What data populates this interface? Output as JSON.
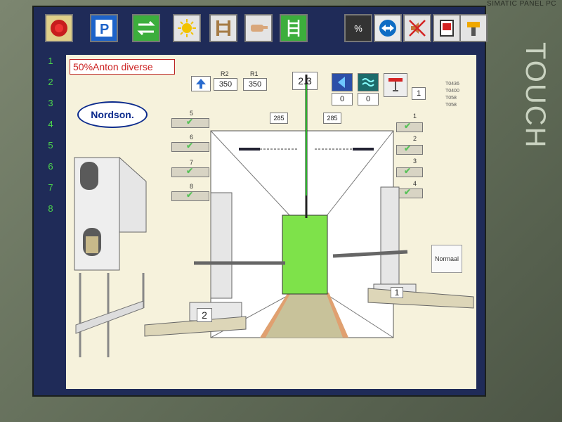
{
  "bezel": {
    "model": "SIMATIC PANEL PC",
    "touch": "TOUCH"
  },
  "toolbar": {
    "buttons": [
      {
        "name": "emergency-stop",
        "icon": "emergency-stop-icon"
      },
      {
        "name": "parking",
        "icon": "parking-icon"
      },
      {
        "name": "conveyor",
        "icon": "conveyor-icon"
      },
      {
        "name": "sun",
        "icon": "sun-icon"
      },
      {
        "name": "rails",
        "icon": "rails-icon"
      },
      {
        "name": "hand",
        "icon": "hand-icon"
      },
      {
        "name": "ladder",
        "icon": "ladder-icon"
      },
      {
        "name": "percent",
        "label": "%"
      },
      {
        "name": "teamviewer",
        "icon": "teamviewer-icon"
      },
      {
        "name": "mute",
        "icon": "mute-icon"
      },
      {
        "name": "tablet",
        "icon": "tablet-icon"
      },
      {
        "name": "tool",
        "icon": "tool-icon"
      }
    ]
  },
  "rows": [
    "1",
    "2",
    "3",
    "4",
    "5",
    "6",
    "7",
    "8"
  ],
  "recipe": {
    "name": "50%Anton diverse"
  },
  "logo": {
    "text": "Nordson."
  },
  "params": {
    "r2_label": "R2",
    "r2_value": "350",
    "r1_label": "R1",
    "r1_value": "350",
    "center_value": "2.3",
    "left_pos": "285",
    "right_pos": "285",
    "air_value": "0",
    "wave_value": "0",
    "count_value": "1"
  },
  "guns_left": [
    "5",
    "6",
    "7",
    "8"
  ],
  "guns_right": [
    "1",
    "2",
    "3",
    "4"
  ],
  "legend": [
    "T0436",
    "T0400",
    "T058",
    "T058"
  ],
  "normal_button": "Normaal",
  "stations": {
    "left": "2",
    "right": "1"
  }
}
